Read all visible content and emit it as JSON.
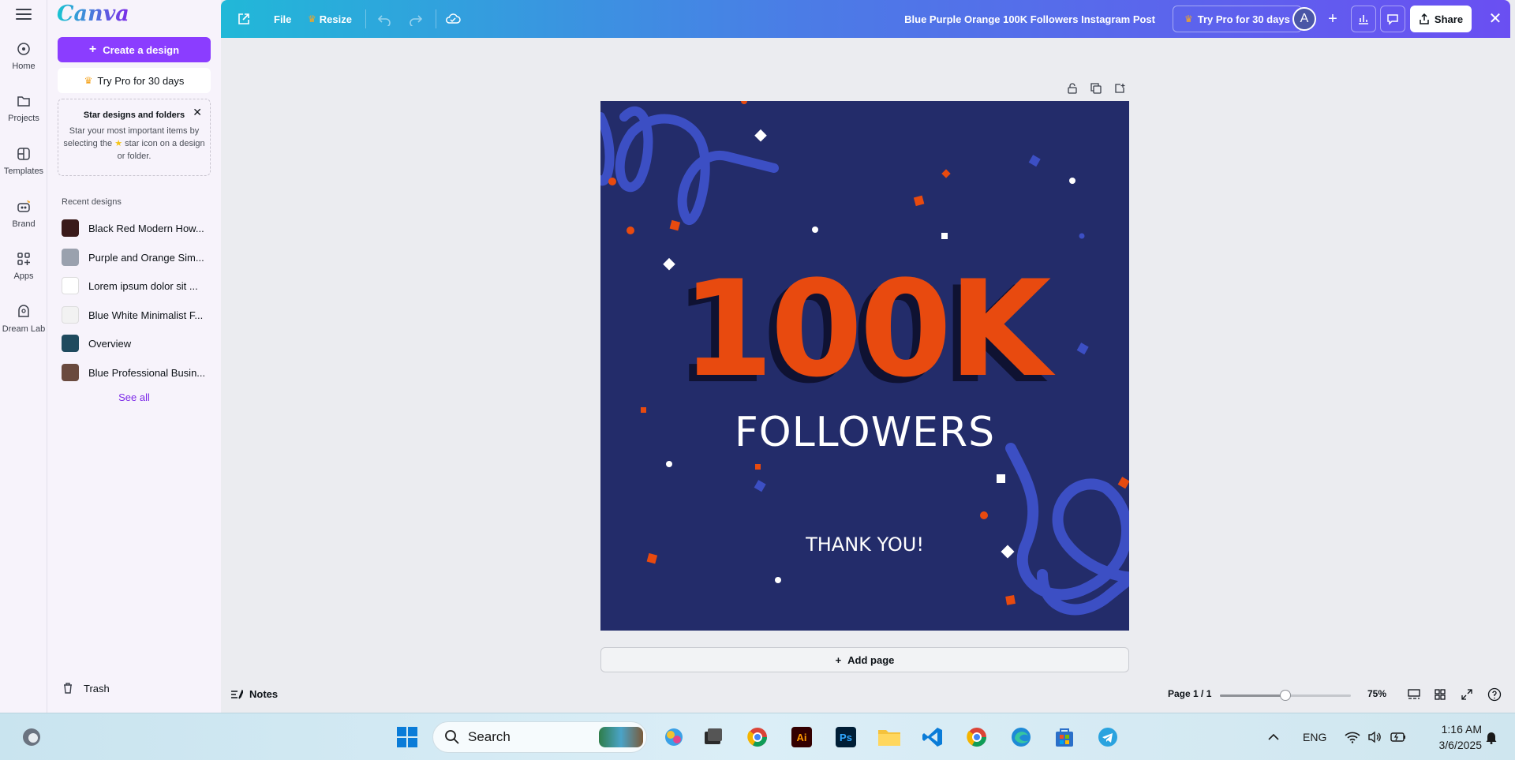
{
  "rail": {
    "items": [
      {
        "label": "Home",
        "icon": "home-icon"
      },
      {
        "label": "Projects",
        "icon": "folder-icon"
      },
      {
        "label": "Templates",
        "icon": "templates-icon"
      },
      {
        "label": "Brand",
        "icon": "brand-icon"
      },
      {
        "label": "Apps",
        "icon": "apps-icon"
      },
      {
        "label": "Dream Lab",
        "icon": "dream-lab-icon"
      }
    ]
  },
  "panel": {
    "logo": "Canva",
    "create_label": "Create a design",
    "try_pro_label": "Try Pro for 30 days",
    "star_card": {
      "title": "Star designs and folders",
      "desc_before": "Star your most important items by selecting the",
      "desc_after": "star icon on a design or folder."
    },
    "recent_heading": "Recent designs",
    "recent": [
      {
        "label": "Black Red Modern How...",
        "color": "#3a1a1a"
      },
      {
        "label": "Purple and Orange Sim...",
        "color": "#9aa1ae"
      },
      {
        "label": "Lorem ipsum dolor sit ...",
        "color": "#ffffff"
      },
      {
        "label": "Blue White Minimalist F...",
        "color": "#f2f2f2"
      },
      {
        "label": "Overview",
        "color": "#1f4a5e"
      },
      {
        "label": "Blue Professional Busin...",
        "color": "#6a4a3e"
      }
    ],
    "see_all": "See all",
    "trash": "Trash"
  },
  "topbar": {
    "file": "File",
    "resize": "Resize",
    "title": "Blue Purple Orange 100K Followers Instagram Post",
    "try_pro": "Try Pro for 30 days",
    "avatar_letter": "A",
    "share": "Share"
  },
  "design": {
    "headline": "100K",
    "subhead": "FOLLOWERS",
    "thanks": "THANK YOU!",
    "colors": {
      "bg": "#232c6a",
      "accent": "#e84a0f",
      "ribbon": "#3c4fc4"
    }
  },
  "canvas": {
    "add_page": "Add page"
  },
  "bottombar": {
    "notes": "Notes",
    "page_info": "Page 1 / 1",
    "zoom_label": "75%",
    "zoom_fraction": 0.5
  },
  "taskbar": {
    "search_placeholder": "Search",
    "language": "ENG",
    "time": "1:16 AM",
    "date": "3/6/2025"
  }
}
